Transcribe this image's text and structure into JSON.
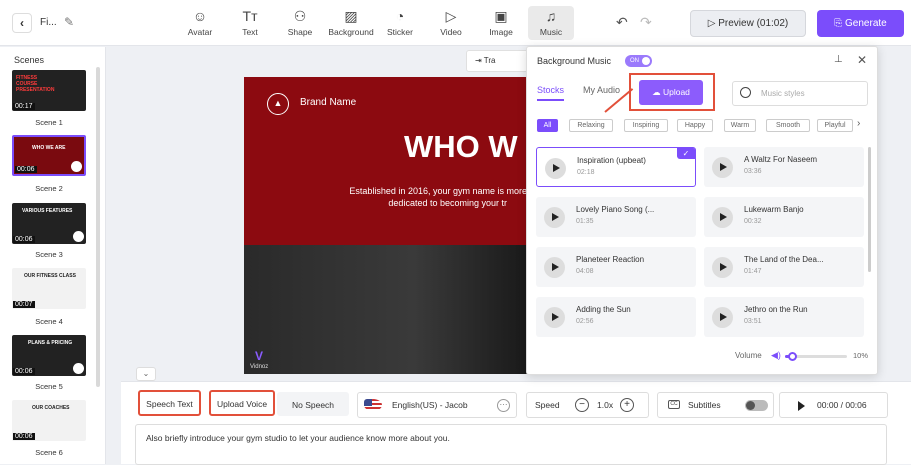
{
  "topbar": {
    "project_name": "Fi...",
    "tools": [
      {
        "label": "Avatar",
        "icon": "avatar-icon",
        "glyph": "☺"
      },
      {
        "label": "Text",
        "icon": "text-icon",
        "glyph": "Tт"
      },
      {
        "label": "Shape",
        "icon": "shape-icon",
        "glyph": "⚇"
      },
      {
        "label": "Background",
        "icon": "background-icon",
        "glyph": "▨"
      },
      {
        "label": "Sticker",
        "icon": "sticker-icon",
        "glyph": "◔"
      },
      {
        "label": "Video",
        "icon": "video-icon",
        "glyph": "▷"
      },
      {
        "label": "Image",
        "icon": "image-icon",
        "glyph": "▣"
      },
      {
        "label": "Music",
        "icon": "music-icon",
        "glyph": "♫"
      }
    ],
    "preview_label": "Preview (01:02)",
    "generate_label": "Generate",
    "accent_color": "#7b4dfb"
  },
  "scenes": {
    "title": "Scenes",
    "items": [
      {
        "label": "Scene 1",
        "time": "00:17",
        "caption": "FITNESS COURSE PRESENTATION"
      },
      {
        "label": "Scene 2",
        "time": "00:06",
        "caption": "WHO WE ARE"
      },
      {
        "label": "Scene 3",
        "time": "00:06",
        "caption": "VARIOUS FEATURES"
      },
      {
        "label": "Scene 4",
        "time": "00:07",
        "caption": "OUR FITNESS CLASS"
      },
      {
        "label": "Scene 5",
        "time": "00:06",
        "caption": "PLANS & PRICING"
      },
      {
        "label": "Scene 6",
        "time": "00:06",
        "caption": "OUR COACHES"
      }
    ]
  },
  "canvas": {
    "brand": "Brand Name",
    "headline": "WHO W",
    "body_line1": "Established in 2016, your gym name is more",
    "body_line2": "dedicated to becoming your tr",
    "watermark": "Vidnoz",
    "transition_label": "Tra"
  },
  "bottom": {
    "speech_text": "Speech Text",
    "upload_voice": "Upload Voice",
    "no_speech": "No Speech",
    "voice": "English(US) - Jacob",
    "speed_label": "Speed",
    "speed_value": "1.0x",
    "subtitles_label": "Subtitles",
    "play_time": "00:00 / 00:06",
    "script": "Also briefly introduce your gym studio to let your audience know more about you."
  },
  "music_panel": {
    "title": "Background Music",
    "toggle": "ON",
    "tab_stocks": "Stocks",
    "tab_my_audio": "My Audio",
    "upload_label": "Upload",
    "search_placeholder": "Music styles",
    "chips": [
      "All",
      "Relaxing",
      "Inspiring",
      "Happy",
      "Warm",
      "Smooth",
      "Playful"
    ],
    "tracks": [
      {
        "name": "Inspiration (upbeat)",
        "duration": "02:18"
      },
      {
        "name": "A Waltz For Naseem",
        "duration": "03:36"
      },
      {
        "name": "Lovely Piano Song (...",
        "duration": "01:35"
      },
      {
        "name": "Lukewarm Banjo",
        "duration": "00:32"
      },
      {
        "name": "Planeteer Reaction",
        "duration": "04:08"
      },
      {
        "name": "The Land of the Dea...",
        "duration": "01:47"
      },
      {
        "name": "Adding the Sun",
        "duration": "02:56"
      },
      {
        "name": "Jethro on the Run",
        "duration": "03:51"
      }
    ],
    "volume_label": "Volume",
    "volume_value": "10%",
    "volume_fraction": 0.1
  }
}
